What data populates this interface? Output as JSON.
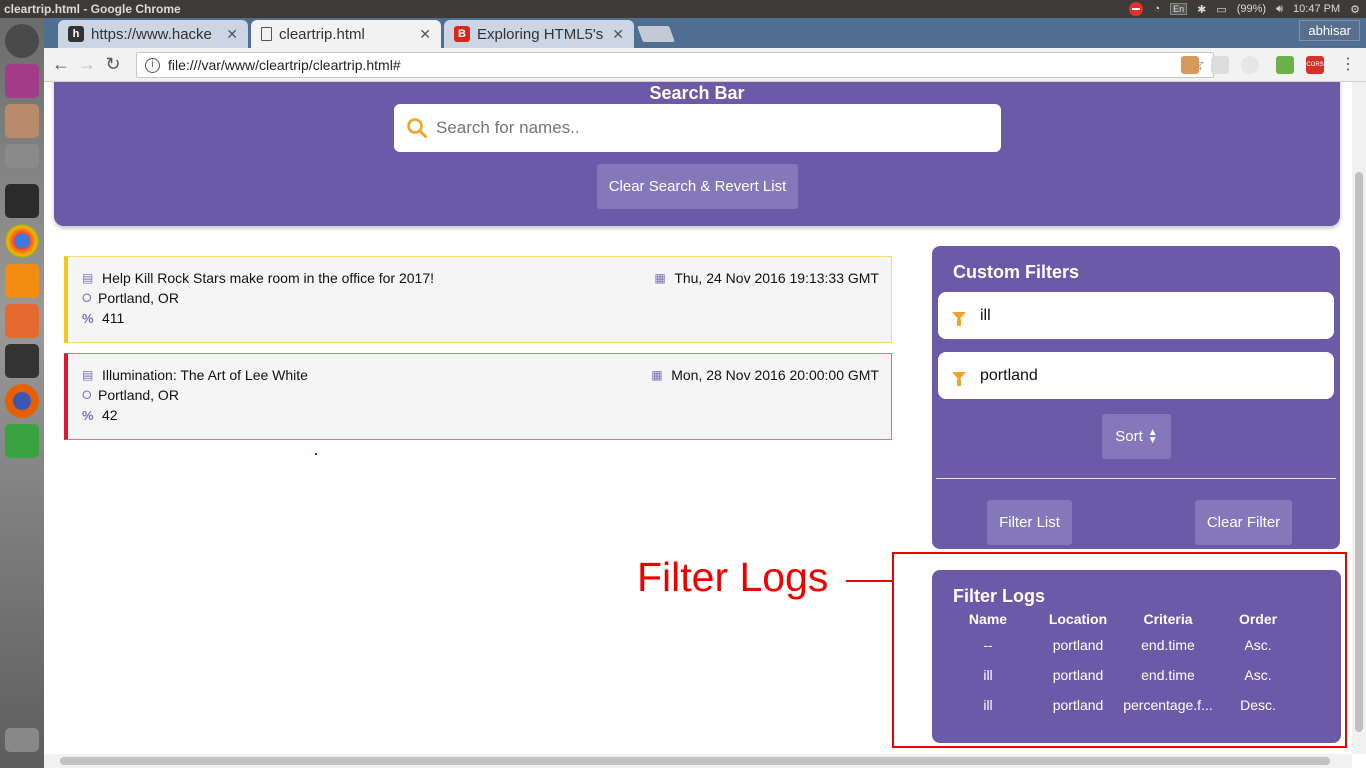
{
  "os": {
    "window_title": "cleartrip.html - Google Chrome",
    "battery": "(99%)",
    "keyboard": "En",
    "clock": "10:47 PM"
  },
  "browser": {
    "tabs": [
      {
        "label": "https://www.hacke",
        "favicon": "h"
      },
      {
        "label": "cleartrip.html",
        "favicon": "doc"
      },
      {
        "label": "Exploring HTML5's",
        "favicon": "B"
      }
    ],
    "user": "abhisar",
    "url": "file:///var/www/cleartrip/cleartrip.html#"
  },
  "search": {
    "title": "Search Bar",
    "placeholder": "Search for names..",
    "clear_label": "Clear Search & Revert List"
  },
  "events": [
    {
      "name": "Help Kill Rock Stars make room in the office for 2017!",
      "date": "Thu, 24 Nov 2016 19:13:33 GMT",
      "location": "Portland, OR",
      "percentage": "411",
      "accent": "#f5c518"
    },
    {
      "name": "Illumination: The Art of Lee White",
      "date": "Mon, 28 Nov 2016 20:00:00 GMT",
      "location": "Portland, OR",
      "percentage": "42",
      "accent": "#e0162b"
    }
  ],
  "custom_filters": {
    "title": "Custom Filters",
    "filters": [
      "ill",
      "portland"
    ],
    "sort_label": "Sort",
    "filter_list_label": "Filter List",
    "clear_filter_label": "Clear Filter"
  },
  "filter_logs": {
    "title": "Filter Logs",
    "columns": [
      "Name",
      "Location",
      "Criteria",
      "Order"
    ],
    "rows": [
      [
        "--",
        "portland",
        "end.time",
        "Asc."
      ],
      [
        "ill",
        "portland",
        "end.time",
        "Asc."
      ],
      [
        "ill",
        "portland",
        "percentage.f...",
        "Desc."
      ]
    ]
  },
  "annotation": {
    "label": "Filter Logs",
    "color": "#e00000"
  },
  "colors": {
    "panel": "#6a5aa8",
    "button": "#8478bb",
    "icon": "#f0a22a"
  }
}
